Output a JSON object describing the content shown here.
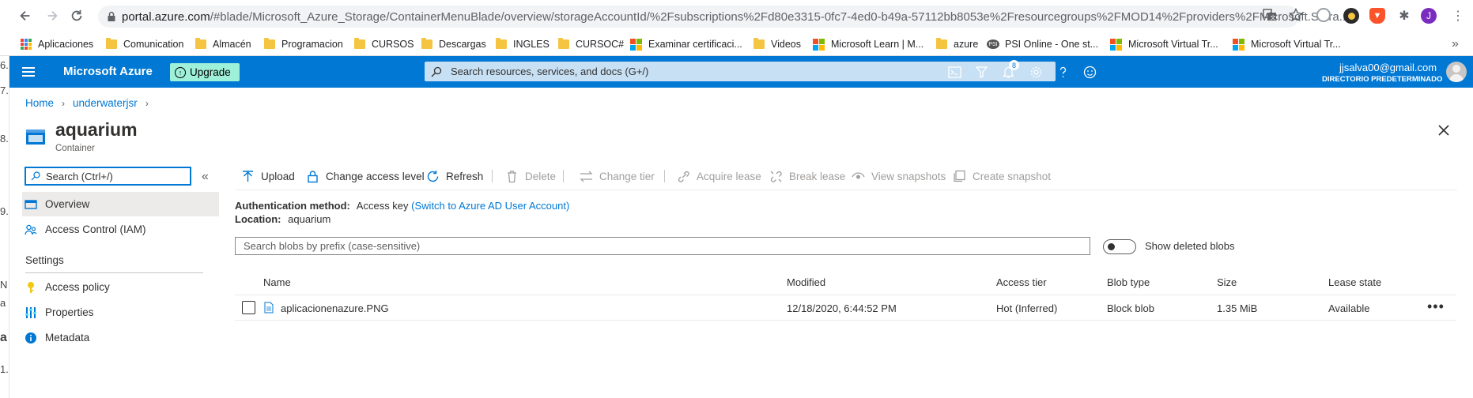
{
  "browser": {
    "url_host": "portal.azure.com",
    "url_path": "/#blade/Microsoft_Azure_Storage/ContainerMenuBlade/overview/storageAccountId/%2Fsubscriptions%2Fd80e3315-0fc7-4ed0-b49a-57112bb8053e%2Fresourcegroups%2FMOD14%2Fproviders%2FMicrosoft.Stora...",
    "profile_initial": "J"
  },
  "bookmarks": [
    {
      "label": "Aplicaciones",
      "icon": "apps-icon"
    },
    {
      "label": "Comunication",
      "icon": "folder-icon"
    },
    {
      "label": "Almacén",
      "icon": "folder-icon"
    },
    {
      "label": "Programacion",
      "icon": "folder-icon"
    },
    {
      "label": "CURSOS",
      "icon": "folder-icon"
    },
    {
      "label": "Descargas",
      "icon": "folder-icon"
    },
    {
      "label": "INGLES",
      "icon": "folder-icon"
    },
    {
      "label": "CURSOC#",
      "icon": "folder-icon"
    },
    {
      "label": "Examinar certificaci...",
      "icon": "microsoft-icon"
    },
    {
      "label": "Videos",
      "icon": "folder-icon"
    },
    {
      "label": "Microsoft Learn | M...",
      "icon": "microsoft-icon"
    },
    {
      "label": "azure",
      "icon": "folder-icon"
    },
    {
      "label": "PSI Online - One st...",
      "icon": "psi-icon"
    },
    {
      "label": "Microsoft Virtual Tr...",
      "icon": "microsoft-icon"
    },
    {
      "label": "Microsoft Virtual Tr...",
      "icon": "microsoft-icon"
    }
  ],
  "peek_chars": [
    "6.",
    "7.",
    "8.",
    "9.",
    "N",
    "a",
    "a",
    "1."
  ],
  "header": {
    "brand": "Microsoft Azure",
    "upgrade_label": "Upgrade",
    "search_placeholder": "Search resources, services, and docs (G+/)",
    "notification_count": "8",
    "account_email": "jjsalva00@gmail.com",
    "account_directory": "DIRECTORIO PREDETERMINADO"
  },
  "breadcrumb": [
    "Home",
    "underwaterjsr"
  ],
  "page": {
    "title": "aquarium",
    "subtitle": "Container"
  },
  "menu": {
    "search_placeholder": "Search (Ctrl+/)",
    "collapse_glyph": "«",
    "items": [
      {
        "label": "Overview"
      },
      {
        "label": "Access Control (IAM)"
      }
    ],
    "settings_header": "Settings",
    "settings_items": [
      {
        "label": "Access policy"
      },
      {
        "label": "Properties"
      },
      {
        "label": "Metadata"
      }
    ]
  },
  "toolbar": {
    "upload": "Upload",
    "change_access": "Change access level",
    "refresh": "Refresh",
    "delete": "Delete",
    "change_tier": "Change tier",
    "acquire_lease": "Acquire lease",
    "break_lease": "Break lease",
    "view_snapshots": "View snapshots",
    "create_snapshot": "Create snapshot"
  },
  "info": {
    "auth_label": "Authentication method:",
    "auth_value": "Access key",
    "auth_link": "(Switch to Azure AD User Account)",
    "location_label": "Location:",
    "location_value": "aquarium"
  },
  "blob_search_placeholder": "Search blobs by prefix (case-sensitive)",
  "show_deleted_label": "Show deleted blobs",
  "table": {
    "columns": [
      "Name",
      "Modified",
      "Access tier",
      "Blob type",
      "Size",
      "Lease state"
    ],
    "rows": [
      {
        "name": "aplicacionenazure.PNG",
        "modified": "12/18/2020, 6:44:52 PM",
        "access_tier": "Hot (Inferred)",
        "blob_type": "Block blob",
        "size": "1.35 MiB",
        "lease_state": "Available"
      }
    ],
    "more_glyph": "•••"
  },
  "colors": {
    "azure_blue": "#0078d4",
    "upgrade_green": "#9ff0d8"
  }
}
